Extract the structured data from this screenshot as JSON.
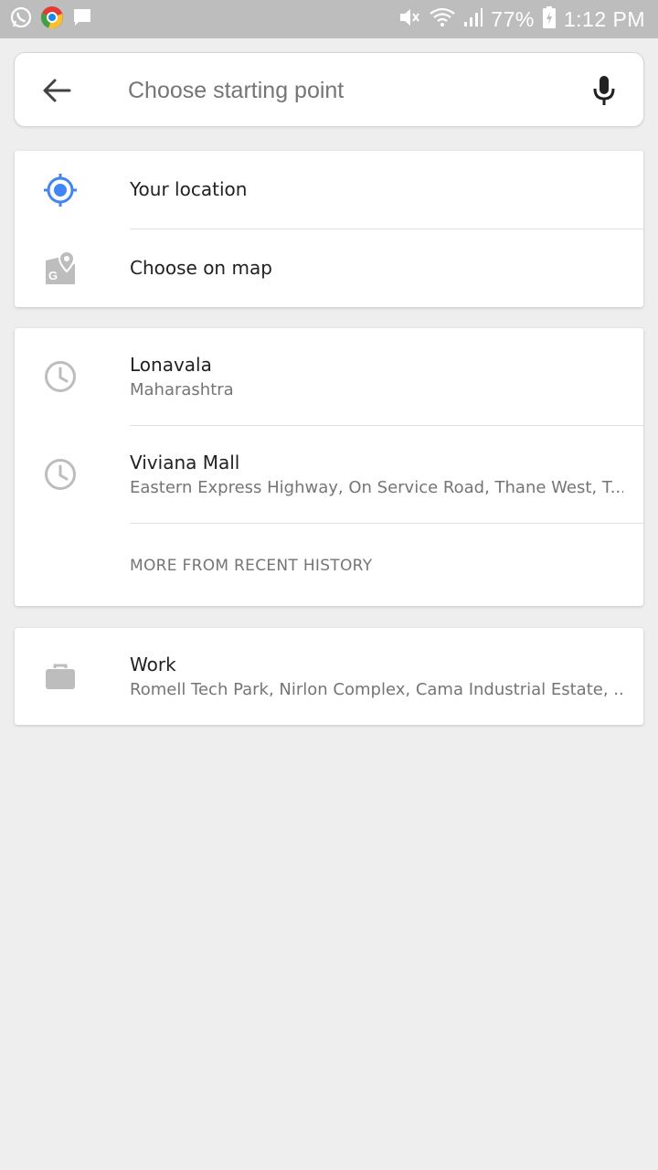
{
  "status_bar": {
    "battery": "77%",
    "time": "1:12 PM",
    "left_icons": [
      "whatsapp-icon",
      "chrome-icon",
      "message-icon"
    ],
    "right_icons": [
      "mute-icon",
      "wifi-icon",
      "signal-icon",
      "battery-charging-icon"
    ]
  },
  "search": {
    "placeholder": "Choose starting point",
    "value": ""
  },
  "quick_options": [
    {
      "label": "Your location",
      "icon": "my-location-icon",
      "accent": "#4285f4"
    },
    {
      "label": "Choose on map",
      "icon": "map-pin-icon"
    }
  ],
  "recent": {
    "items": [
      {
        "title": "Lonavala",
        "subtitle": "Maharashtra",
        "icon": "history-icon"
      },
      {
        "title": "Viviana Mall",
        "subtitle": "Eastern Express Highway, On Service Road, Thane West, T...",
        "icon": "history-icon"
      }
    ],
    "more_label": "MORE FROM RECENT HISTORY"
  },
  "saved": {
    "items": [
      {
        "title": "Work",
        "subtitle": "Romell Tech Park, Nirlon Complex, Cama Industrial Estate, ...",
        "icon": "briefcase-icon"
      }
    ]
  },
  "colors": {
    "accent": "#4285f4",
    "icon_grey": "#bdbdbd",
    "background": "#eeeeee"
  }
}
